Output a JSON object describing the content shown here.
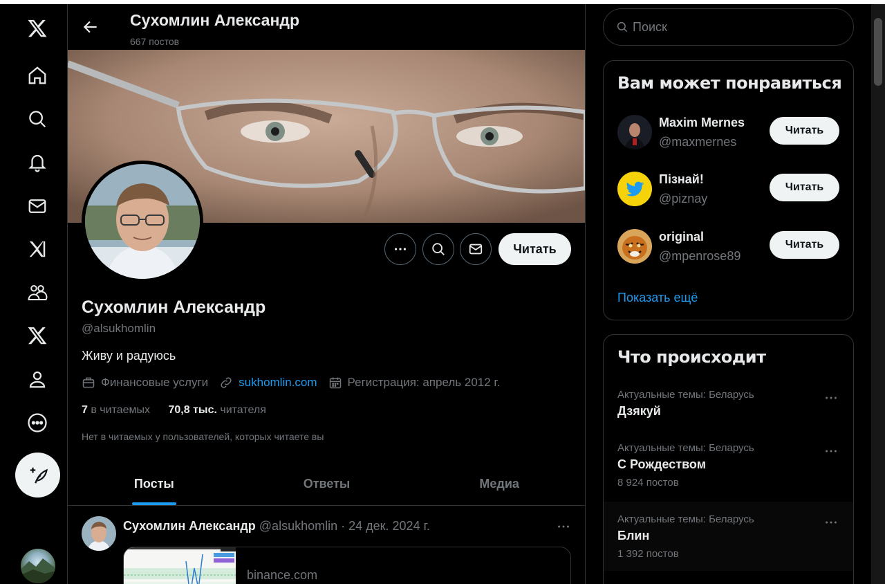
{
  "header": {
    "name": "Сухомлин Александр",
    "posts_count": "667 постов"
  },
  "profile": {
    "name": "Сухомлин Александр",
    "handle": "@alsukhomlin",
    "bio": "Живу и радуюсь",
    "category": "Финансовые услуги",
    "website": "sukhomlin.com",
    "joined": "Регистрация: апрель 2012 г.",
    "following_count": "7",
    "following_label": "в читаемых",
    "followers_count": "70,8 тыс.",
    "followers_label": "читателя",
    "note": "Нет в читаемых у пользователей, которых читаете вы",
    "follow_label": "Читать"
  },
  "tabs": [
    {
      "label": "Посты",
      "active": true
    },
    {
      "label": "Ответы",
      "active": false
    },
    {
      "label": "Медиа",
      "active": false
    }
  ],
  "post": {
    "author": "Сухомлин Александр",
    "handle": "@alsukhomlin",
    "date": "· 24 дек. 2024 г.",
    "card_domain": "binance.com"
  },
  "search": {
    "placeholder": "Поиск"
  },
  "who_to_follow": {
    "title": "Вам может понравиться",
    "items": [
      {
        "name": "Maxim Mernes",
        "handle": "@maxmernes",
        "button": "Читать"
      },
      {
        "name": "Пізнай!",
        "handle": "@piznay",
        "button": "Читать"
      },
      {
        "name": "original",
        "handle": "@mpenrose89",
        "button": "Читать"
      }
    ],
    "show_more": "Показать ещё"
  },
  "trends": {
    "title": "Что происходит",
    "items": [
      {
        "context": "Актуальные темы: Беларусь",
        "topic": "Дзякуй",
        "count": ""
      },
      {
        "context": "Актуальные темы: Беларусь",
        "topic": "С Рождеством",
        "count": "8 924 постов"
      },
      {
        "context": "Актуальные темы: Беларусь",
        "topic": "Блин",
        "count": "1 392 постов"
      }
    ]
  },
  "colors": {
    "accent": "#1d9bf0",
    "background": "#000000",
    "secondary_text": "#71767b",
    "border": "#2f3336"
  }
}
